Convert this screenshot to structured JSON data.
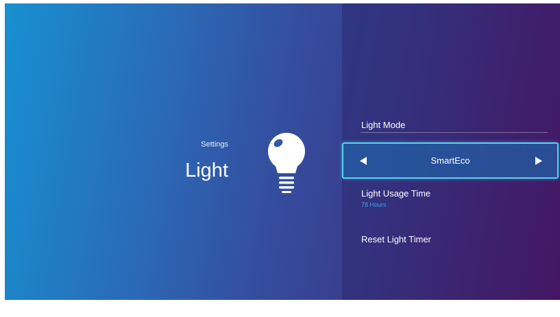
{
  "header": {
    "section": "Settings",
    "title": "Light",
    "icon": "lightbulb-icon"
  },
  "menu": {
    "light_mode": {
      "label": "Light Mode",
      "value": "SmartEco",
      "left_icon": "arrow-left-icon",
      "right_icon": "arrow-right-icon"
    },
    "light_usage_time": {
      "label": "Light Usage Time",
      "value": "78 Hours"
    },
    "reset_light_timer": {
      "label": "Reset Light Timer"
    }
  },
  "colors": {
    "accent": "#4fd8f2",
    "usage_value": "#3aa6e6",
    "bg_left": "#1790d0",
    "bg_right": "#441764"
  }
}
